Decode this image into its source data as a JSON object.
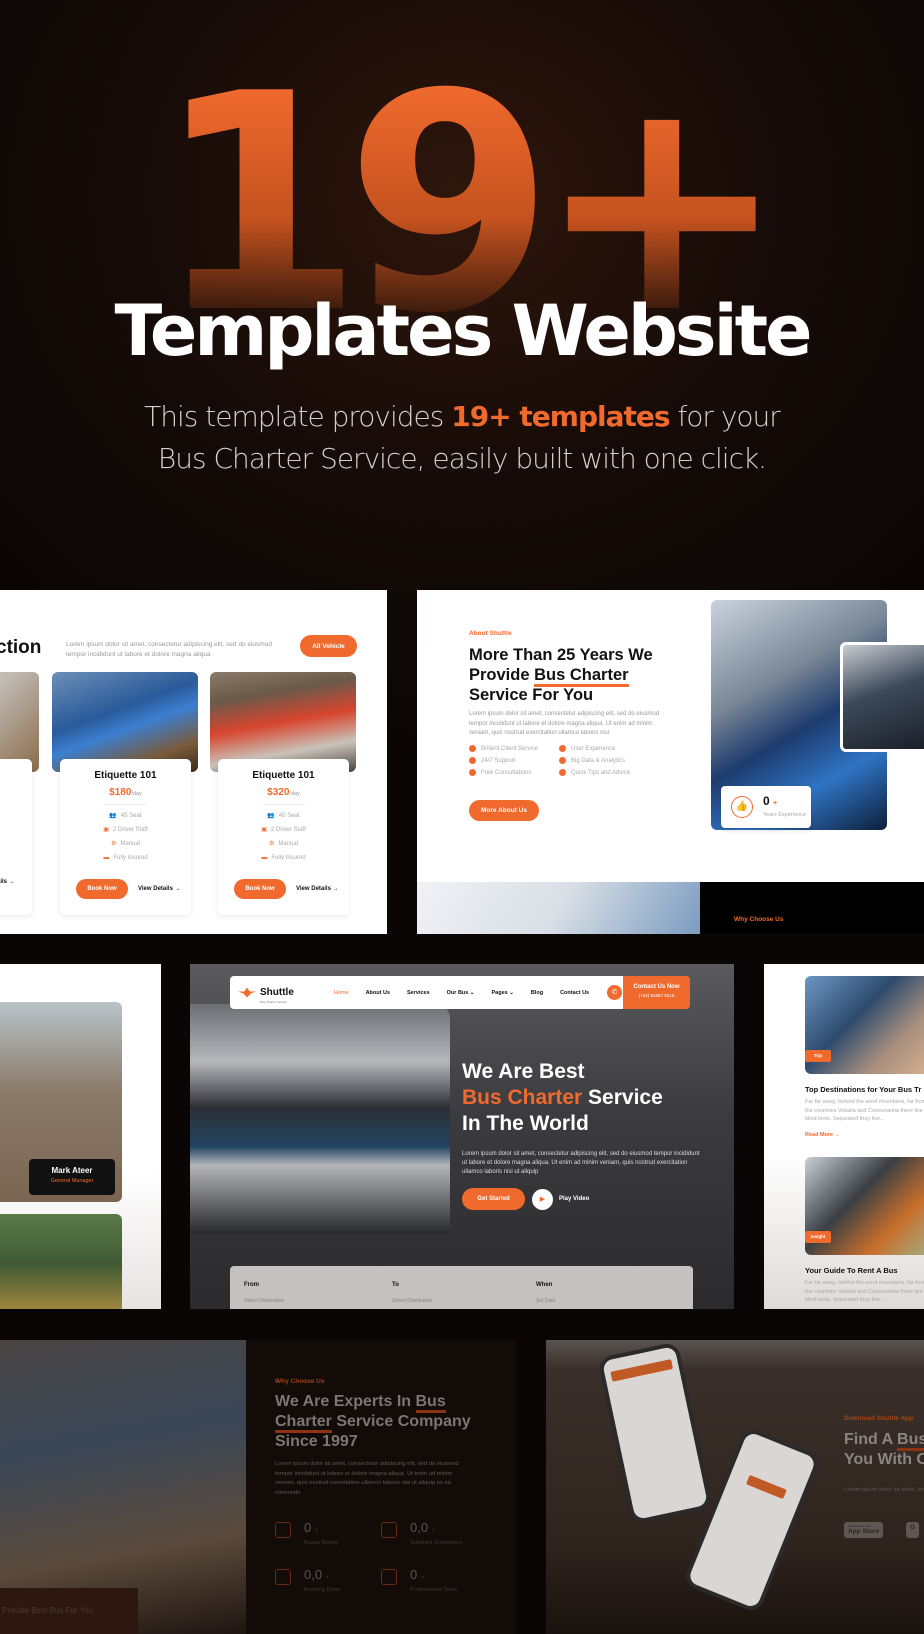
{
  "hero": {
    "big_number": "19+",
    "title": "Templates Website",
    "subtitle_pre": "This template provides ",
    "subtitle_highlight": "19+ templates",
    "subtitle_post": " for your",
    "subtitle_line2": "Bus Charter Service, easily built with one click."
  },
  "accent_color": "#f06a2e",
  "fleet": {
    "title_partial": "ction",
    "description": "Lorem ipsum dolor sit amet, consectetur adipiscing elit, sed do eiusmod tempor incididunt ut labore et dolore magna aliqua",
    "all_button": "All Vehicle",
    "partial_view": "ails →",
    "cards": [
      {
        "name": "Etiquette 101",
        "price": "$180",
        "unit": "/day",
        "specs": [
          "45 Seat",
          "2 Driver Staff",
          "Manual",
          "Fully Insured"
        ],
        "book": "Book Now",
        "view": "View Details →"
      },
      {
        "name": "Etiquette 101",
        "price": "$320",
        "unit": "/day",
        "specs": [
          "45 Seat",
          "2 Driver Staff",
          "Manual",
          "Fully Insured"
        ],
        "book": "Book Now",
        "view": "View Details →"
      }
    ]
  },
  "about": {
    "kicker": "About Shuttle",
    "title_pre": "More Than 25 Years We Provide ",
    "title_highlight": "Bus Charter",
    "title_post": " Service For You",
    "description": "Lorem ipsum dolor sit amet, consectetur adipiscing elit, sed do eiusmod tempor incididunt ut labore et dolore magna aliqua. Ut enim ad minim veniam, quis nostrud exercitation ullamco laboris nisi",
    "features": [
      "Brilient Client Service",
      "User Experience",
      "24/7 Support",
      "Big Data & Analytics",
      "Free Consultations",
      "Quick Tips and Advice"
    ],
    "button": "More About Us",
    "exp_value": "0",
    "exp_plus": "+",
    "exp_label": "Years Experience",
    "why_kicker": "Why Choose Us"
  },
  "team": {
    "member_name": "Mark Ateer",
    "member_role": "General Manager"
  },
  "home": {
    "brand": "Shuttle",
    "brand_tagline": "Bus Charter Service",
    "menu": [
      "Home",
      "About Us",
      "Services",
      "Our Bus ⌄",
      "Pages ⌄",
      "Blog",
      "Contact Us"
    ],
    "cta_title": "Contact Us Now",
    "cta_phone": "(+62) 81587 6215",
    "headline_1": "We Are Best",
    "headline_hl": "Bus Charter",
    "headline_2": " Service",
    "headline_3": "In The World",
    "description": "Lorem ipsum dolor sit amet, consectetur adipiscing elit, sed do eiusmod tempor incididunt ut labore et dolore magna aliqua. Ut enim ad minim veniam, quis nostrud exercitation ullamco laboris nisi ut aliquip",
    "get_started": "Get Started",
    "play_video": "Play Video",
    "form": {
      "from_label": "From",
      "from_placeholder": "Select Destination",
      "to_label": "To",
      "to_placeholder": "Select Destination",
      "when_label": "When",
      "when_placeholder": "Set Date"
    }
  },
  "blog": {
    "posts": [
      {
        "tag": "Trip",
        "title": "Top Destinations for Your Bus Tr",
        "excerpt": "Far far away, behind the word mountains, far from the countries Vokalia and Consonantia there live the blind texts. Separated they live...",
        "read_more": "Read More →"
      },
      {
        "tag": "Insight",
        "title": "Your Guide To Rent A Bus",
        "excerpt": "Far far away, behind the word mountains, far from the countries Vokalia and Consonantia there live the blind texts. Separated they live..."
      }
    ]
  },
  "why": {
    "photo_caption": "Provide Best Bus For You",
    "kicker": "Why Choose Us",
    "title_pre": "We Are Experts In ",
    "title_highlight": "Bus Charter",
    "title_post": " Service Company Since 1997",
    "description": "Lorem ipsum dolor sit amet, consectetur adipiscing elit, sed do eiusmod tempor incididunt ut labore et dolore magna aliqua. Ut enim ad minim veniam, quis nostrud exercitation ullamco laboris nisi ut aliquip ex ea commodo",
    "stats": [
      {
        "value": "0",
        "label": "Buses Ready"
      },
      {
        "value": "0,0",
        "label": "Satisfied Customers"
      },
      {
        "value": "0,0",
        "label": "Booking Done"
      },
      {
        "value": "0",
        "label": "Professional Team"
      }
    ]
  },
  "app": {
    "kicker": "Download Shuttle App",
    "title_pre": "Find A ",
    "title_highlight": "Bus",
    "title_line2": "You With O",
    "description": "Lorem ipsum dolor sit amet, tempor incididunt ut labore veniam, quis nostrud exercita",
    "app_store_small": "Download on the",
    "app_store": "App Store",
    "play_store": "G"
  }
}
